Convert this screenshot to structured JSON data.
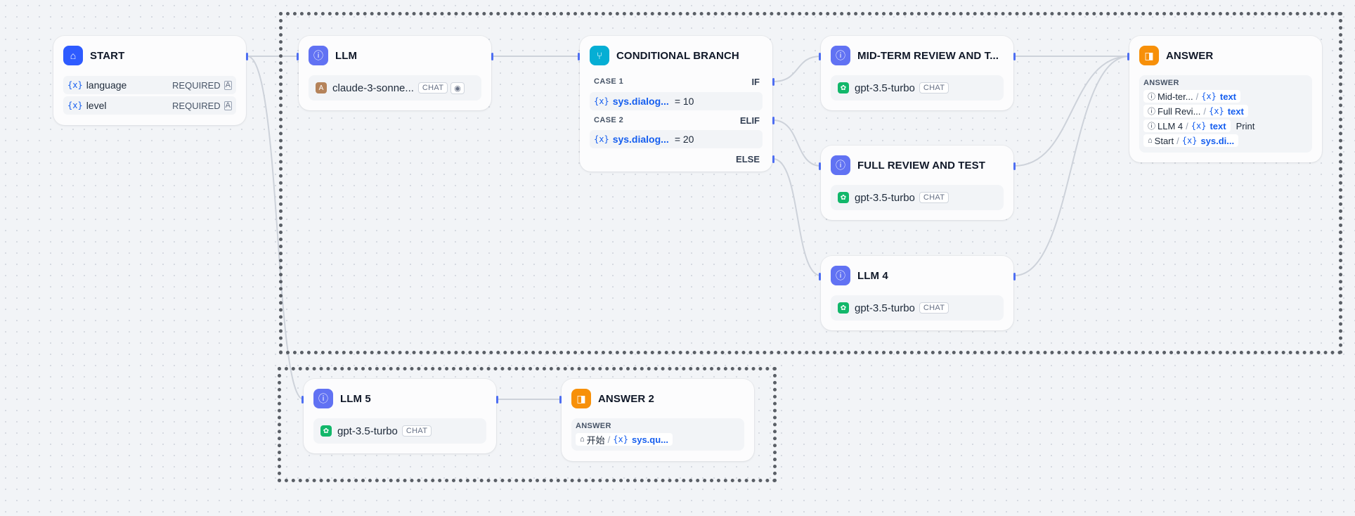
{
  "nodes": {
    "start": {
      "title": "START",
      "vars": [
        {
          "name": "language",
          "required": "REQUIRED"
        },
        {
          "name": "level",
          "required": "REQUIRED"
        }
      ]
    },
    "llm": {
      "title": "LLM",
      "model": "claude-3-sonne...",
      "badge": "CHAT"
    },
    "branch": {
      "title": "CONDITIONAL BRANCH",
      "case1": "CASE 1",
      "if_label": "IF",
      "case1_var": "sys.dialog...",
      "case1_cond": "= 10",
      "case2": "CASE 2",
      "elif_label": "ELIF",
      "case2_var": "sys.dialog...",
      "case2_cond": "= 20",
      "else_label": "ELSE"
    },
    "midterm": {
      "title": "MID-TERM REVIEW AND T...",
      "model": "gpt-3.5-turbo",
      "badge": "CHAT"
    },
    "full": {
      "title": "FULL REVIEW AND TEST",
      "model": "gpt-3.5-turbo",
      "badge": "CHAT"
    },
    "llm4": {
      "title": "LLM 4",
      "model": "gpt-3.5-turbo",
      "badge": "CHAT"
    },
    "answer": {
      "title": "ANSWER",
      "label": "ANSWER",
      "lines": [
        {
          "node": "Mid-ter...",
          "var": "text",
          "extra": ""
        },
        {
          "node": "Full Revi...",
          "var": "text",
          "extra": ""
        },
        {
          "node": "LLM 4",
          "var": "text",
          "extra": "Print"
        },
        {
          "node": "Start",
          "var": "sys.di...",
          "extra": ""
        }
      ]
    },
    "llm5": {
      "title": "LLM 5",
      "model": "gpt-3.5-turbo",
      "badge": "CHAT"
    },
    "answer2": {
      "title": "ANSWER 2",
      "label": "ANSWER",
      "line": {
        "node": "开始",
        "var": "sys.qu..."
      }
    }
  },
  "icons": {
    "start": "home-icon",
    "llm": "llm-icon",
    "branch": "branch-icon",
    "answer": "answer-icon",
    "variable": "variable-icon"
  },
  "colors": {
    "start_icon": "#2e5bff",
    "llm_icon": "#6172f3",
    "branch_icon": "#06aed4",
    "answer_icon": "#f79009",
    "edge": "#d0d5dd",
    "handle": "#4e6ef2",
    "variable_text": "#155eef"
  }
}
